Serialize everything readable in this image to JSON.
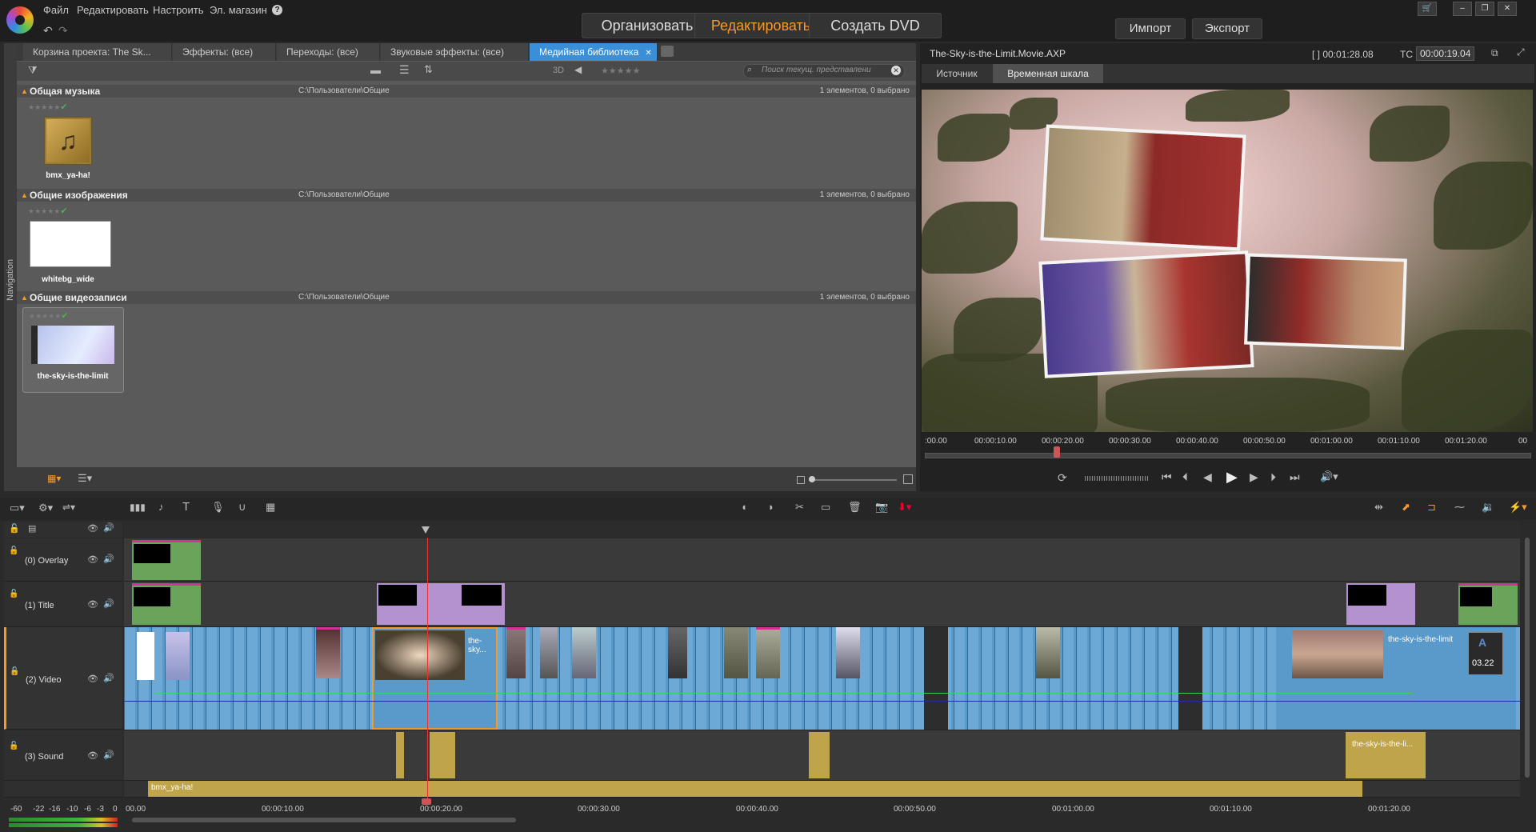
{
  "menu": {
    "file": "Файл",
    "edit": "Редактировать",
    "settings": "Настроить",
    "shop": "Эл. магазин",
    "help": "?"
  },
  "modes": {
    "organize": "Организовать",
    "edit": "Редактировать",
    "dvd": "Создать DVD"
  },
  "io": {
    "import": "Импорт",
    "export": "Экспорт"
  },
  "library": {
    "navigation_label": "Navigation",
    "tabs": [
      "Корзина проекта: The Sk...",
      "Эффекты: (все)",
      "Переходы: (все)",
      "Звуковые эффекты: (все)",
      "Медийная библиотека"
    ],
    "toolbar": {
      "three_d": "3D",
      "search_placeholder": "Поиск текущ. представлени"
    },
    "sections": [
      {
        "name": "Общая музыка",
        "path": "C:\\Пользователи\\Общие",
        "count": "1 элементов, 0 выбрано",
        "item": "bmx_ya-ha!"
      },
      {
        "name": "Общие изображения",
        "path": "C:\\Пользователи\\Общие",
        "count": "1 элементов, 0 выбрано",
        "item": "whitebg_wide"
      },
      {
        "name": "Общие видеозаписи",
        "path": "C:\\Пользователи\\Общие",
        "count": "1 элементов, 0 выбрано",
        "item": "the-sky-is-the-limit"
      }
    ]
  },
  "preview": {
    "filename": "The-Sky-is-the-Limit.Movie.AXP",
    "duration": "[ ] 00:01:28.08",
    "tc_label": "TC",
    "timecode": "00:00:19.04",
    "tabs": {
      "source": "Источник",
      "timeline": "Временная шкала"
    },
    "ruler": [
      ":00.00",
      "00:00:10.00",
      "00:00:20.00",
      "00:00:30.00",
      "00:00:40.00",
      "00:00:50.00",
      "00:01:00.00",
      "00:01:10.00",
      "00:01:20.00",
      "00"
    ]
  },
  "tracks": [
    {
      "name": "(0) Overlay"
    },
    {
      "name": "(1) Title"
    },
    {
      "name": "(2) Video"
    },
    {
      "name": "(3) Sound"
    }
  ],
  "clips": {
    "sky1": "the-sky...",
    "sky2": "the-sky-is-the-limit",
    "sound_clip": "the-sky-is-the-li...",
    "music": "bmx_ya-ha!",
    "title_time": "03.22",
    "title_letter": "A"
  },
  "meter": {
    "scale": [
      "-60",
      "-22",
      "-16",
      "-10",
      "-6",
      "-3",
      "0"
    ]
  },
  "timeline_ruler": [
    "00.00",
    "00:00:10.00",
    "00:00:20.00",
    "00:00:30.00",
    "00:00:40.00",
    "00:00:50.00",
    "00:01:00.00",
    "00:01:10.00",
    "00:01:20.00"
  ]
}
